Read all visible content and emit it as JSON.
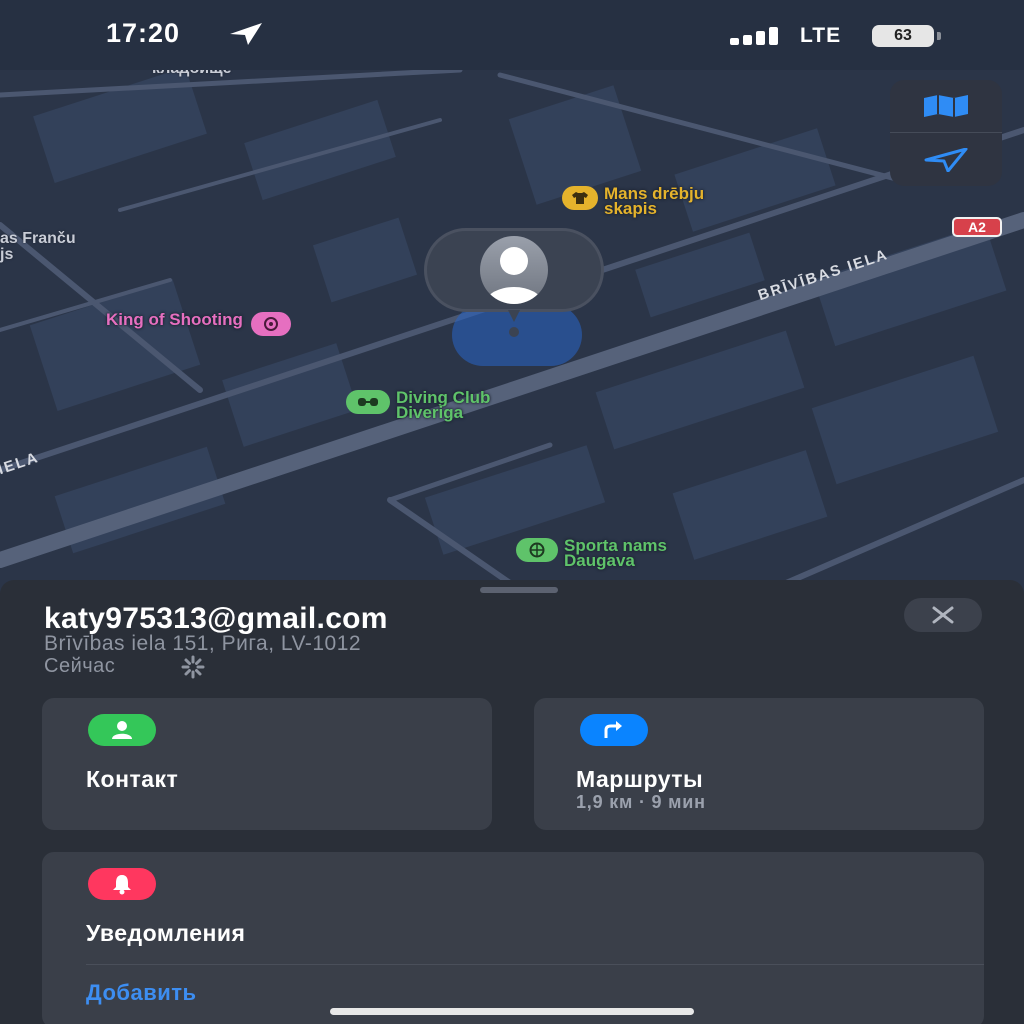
{
  "status_bar": {
    "time": "17:20",
    "carrier": "LTE",
    "battery": "63"
  },
  "map": {
    "labels": {
      "cemetery": "кладбище",
      "franču": "as Franču",
      "franču_2": "js",
      "street_left": "IELA"
    },
    "road_name": "BRĪVĪBAS IELA",
    "route_shield": "A2",
    "pois": {
      "mans": {
        "line1": "Mans drēbju",
        "line2": "skapis",
        "color": "#e5b32c",
        "icon": "shirt-icon"
      },
      "king": {
        "line1": "King of Shooting",
        "color": "#e66fc0",
        "icon": "target-icon"
      },
      "diving": {
        "line1": "Diving Club",
        "line2": "Diveriga",
        "color": "#5fc36a",
        "icon": "diving-mask-icon"
      },
      "sporta": {
        "line1": "Sporta nams",
        "line2": "Daugava",
        "color": "#5fc36a",
        "icon": "basketball-icon"
      }
    },
    "controls": {
      "map_mode_icon": "map-icon",
      "locate_icon": "location-arrow-icon"
    }
  },
  "sheet": {
    "email": "katy975313@gmail.com",
    "address": "Brīvības iela 151, Рига, LV-1012",
    "time_label": "Сейчас",
    "close_icon": "close-icon",
    "contact": {
      "label": "Контакт",
      "color": "#34c759"
    },
    "directions": {
      "label": "Маршруты",
      "detail": "1,9 км · 9 мин",
      "color": "#0a84ff"
    },
    "notifications": {
      "label": "Уведомления",
      "add_label": "Добавить",
      "color": "#ff375f"
    }
  }
}
